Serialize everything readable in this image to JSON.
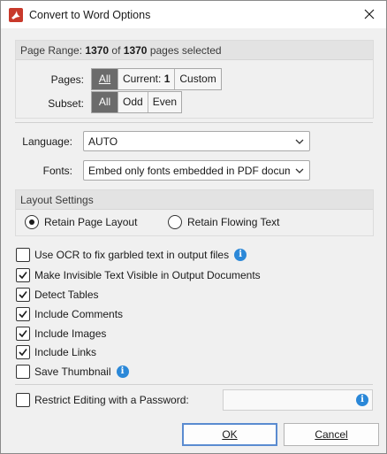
{
  "window": {
    "title": "Convert to Word Options",
    "close_icon": "close-icon"
  },
  "page_range": {
    "prefix": "Page Range: ",
    "current": "1370",
    "of": " of ",
    "total": "1370",
    "suffix": " pages selected",
    "pages_label": "Pages:",
    "pages_options": [
      {
        "label": "All",
        "active": true
      },
      {
        "label_prefix": "Current: ",
        "label_value": "1",
        "active": false
      },
      {
        "label": "Custom",
        "active": false
      }
    ],
    "subset_label": "Subset:",
    "subset_options": [
      {
        "label": "All",
        "active": true
      },
      {
        "label": "Odd",
        "active": false
      },
      {
        "label": "Even",
        "active": false
      }
    ]
  },
  "language": {
    "label": "Language:",
    "value": "AUTO"
  },
  "fonts": {
    "label": "Fonts:",
    "value": "Embed only fonts embedded in PDF document"
  },
  "layout": {
    "header": "Layout Settings",
    "options": [
      {
        "label": "Retain Page Layout",
        "selected": true
      },
      {
        "label": "Retain Flowing Text",
        "selected": false
      }
    ]
  },
  "checkboxes": [
    {
      "label": "Use OCR to fix garbled text in output files",
      "checked": false,
      "info": true
    },
    {
      "label": "Make Invisible Text Visible in Output Documents",
      "checked": true,
      "info": false
    },
    {
      "label": "Detect Tables",
      "checked": true,
      "info": false
    },
    {
      "label": "Include Comments",
      "checked": true,
      "info": false
    },
    {
      "label": "Include Images",
      "checked": true,
      "info": false
    },
    {
      "label": "Include Links",
      "checked": true,
      "info": false
    },
    {
      "label": "Save Thumbnail",
      "checked": false,
      "info": true
    }
  ],
  "password": {
    "label": "Restrict Editing with a Password:",
    "checked": false,
    "value": ""
  },
  "buttons": {
    "ok": "OK",
    "cancel": "Cancel"
  },
  "colors": {
    "accent": "#2b88d8",
    "app_icon": "#c8392b",
    "segment_active": "#6b6b6b"
  }
}
